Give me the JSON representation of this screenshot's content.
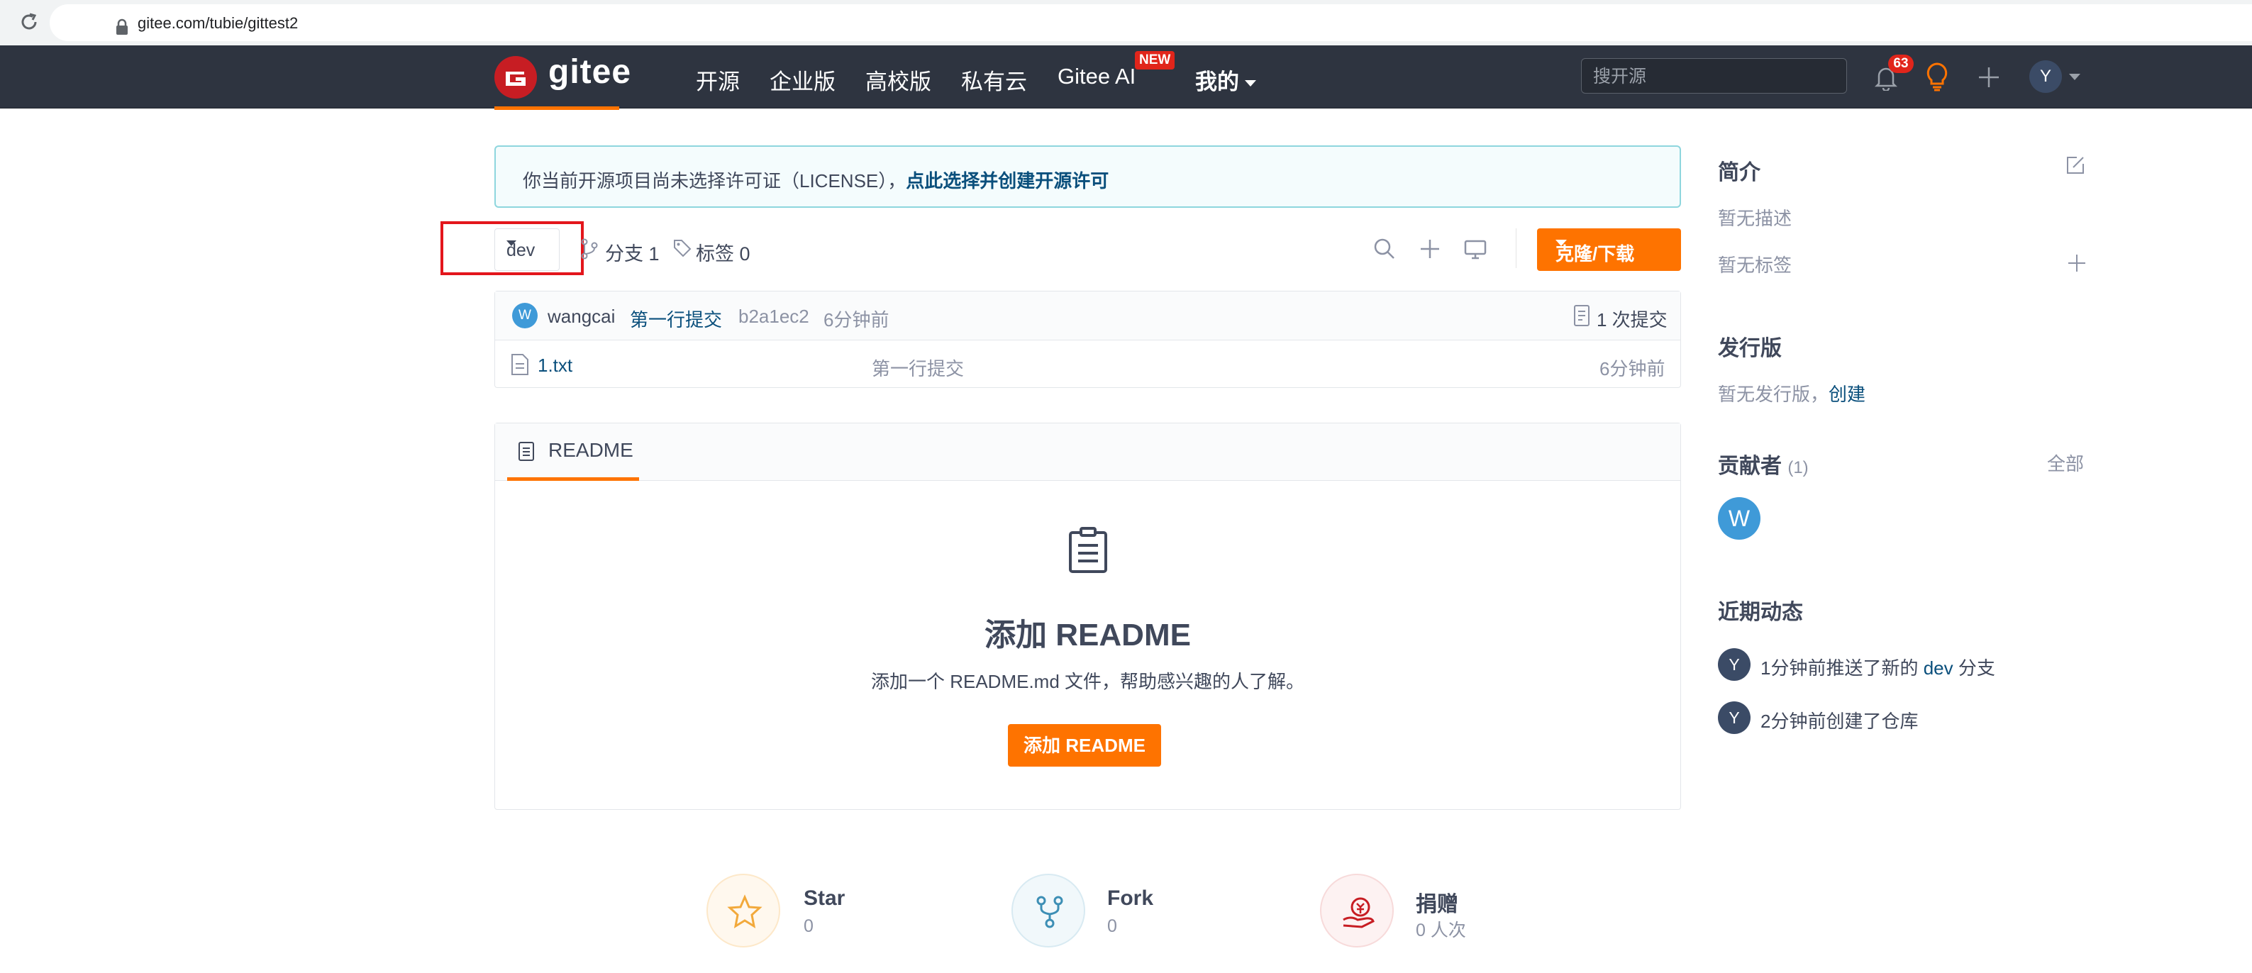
{
  "browser": {
    "url": "gitee.com/tubie/gittest2"
  },
  "header": {
    "logo_text": "gitee",
    "nav": [
      "开源",
      "企业版",
      "高校版",
      "私有云",
      "Gitee AI",
      "我的"
    ],
    "new_badge": "NEW",
    "search_placeholder": "搜开源",
    "notification_count": "63",
    "user_initial": "Y"
  },
  "license_notice": {
    "text": "你当前开源项目尚未选择许可证（LICENSE），",
    "link": "点此选择并创建开源许可"
  },
  "toolbar": {
    "branch": "dev",
    "branch_count": "分支 1",
    "tag_count": "标签 0",
    "clone_label": "克隆/下载"
  },
  "commit": {
    "avatar_initial": "W",
    "author": "wangcai",
    "message": "第一行提交",
    "hash": "b2a1ec2",
    "time": "6分钟前",
    "total": "1 次提交"
  },
  "files": [
    {
      "name": "1.txt",
      "message": "第一行提交",
      "time": "6分钟前"
    }
  ],
  "readme": {
    "tab": "README",
    "title": "添加 README",
    "desc": "添加一个 README.md 文件，帮助感兴趣的人了解。",
    "button": "添加 README"
  },
  "stats": [
    {
      "label": "Star",
      "value": "0"
    },
    {
      "label": "Fork",
      "value": "0"
    },
    {
      "label": "捐赠",
      "value": "0 人次"
    }
  ],
  "sidebar": {
    "intro_title": "简介",
    "intro_desc": "暂无描述",
    "intro_tags": "暂无标签",
    "release_title": "发行版",
    "release_text": "暂无发行版，",
    "release_link": "创建",
    "contrib_title": "贡献者",
    "contrib_count": "(1)",
    "contrib_all": "全部",
    "contrib_initial": "W",
    "activity_title": "近期动态",
    "activities": [
      {
        "initial": "Y",
        "before": "1分钟前推送了新的 ",
        "link": "dev",
        "after": " 分支"
      },
      {
        "initial": "Y",
        "before": "2分钟前创建了仓库",
        "link": "",
        "after": ""
      }
    ]
  },
  "colors": {
    "header_bg": "#2e3440",
    "accent_orange": "#fe7300",
    "link_blue": "#0a4f7c",
    "badge_red": "#e1251b",
    "highlight_red": "#e3161c"
  }
}
